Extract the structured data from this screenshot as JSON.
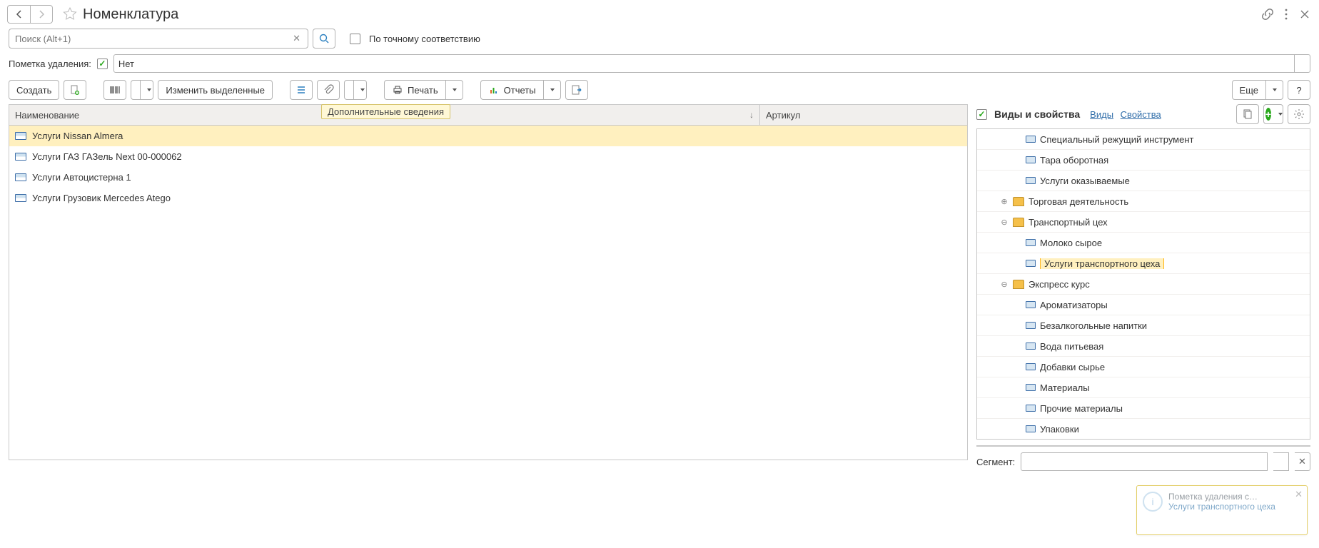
{
  "header": {
    "title": "Номенклатура",
    "search_placeholder": "Поиск (Alt+1)",
    "exact_match": "По точному соответствию",
    "filter_label": "Пометка удаления:",
    "filter_value": "Нет"
  },
  "toolbar": {
    "create": "Создать",
    "change_selected": "Изменить выделенные",
    "print": "Печать",
    "reports": "Отчеты",
    "more": "Еще",
    "help": "?",
    "tooltip": "Дополнительные сведения"
  },
  "table": {
    "columns": {
      "name": "Наименование",
      "article": "Артикул"
    },
    "rows": [
      {
        "name": "Услуги  Nissan Almera",
        "article": "",
        "selected": true
      },
      {
        "name": "Услуги  ГАЗ ГАЗель Next 00-000062",
        "article": "",
        "selected": false
      },
      {
        "name": "Услуги Автоцистерна 1",
        "article": "",
        "selected": false
      },
      {
        "name": "Услуги Грузовик Mercedes Atego",
        "article": "",
        "selected": false
      }
    ]
  },
  "right": {
    "title": "Виды и свойства",
    "link_types": "Виды",
    "link_props": "Свойства",
    "tree": [
      {
        "depth": 2,
        "exp": "",
        "kind": "leaf",
        "label": "Специальный режущий инструмент",
        "sel": false
      },
      {
        "depth": 2,
        "exp": "",
        "kind": "leaf",
        "label": "Тара оборотная",
        "sel": false
      },
      {
        "depth": 2,
        "exp": "",
        "kind": "leaf",
        "label": "Услуги оказываемые",
        "sel": false
      },
      {
        "depth": 1,
        "exp": "plus",
        "kind": "folder",
        "label": "Торговая деятельность",
        "sel": false
      },
      {
        "depth": 1,
        "exp": "minus",
        "kind": "folder",
        "label": "Транспортный  цех",
        "sel": false
      },
      {
        "depth": 2,
        "exp": "",
        "kind": "leaf",
        "label": "Молоко сырое",
        "sel": false
      },
      {
        "depth": 2,
        "exp": "",
        "kind": "leaf",
        "label": "Услуги  транспортного цеха",
        "sel": true
      },
      {
        "depth": 1,
        "exp": "minus",
        "kind": "folder",
        "label": "Экспресс курс",
        "sel": false
      },
      {
        "depth": 2,
        "exp": "",
        "kind": "leaf",
        "label": "Ароматизаторы",
        "sel": false
      },
      {
        "depth": 2,
        "exp": "",
        "kind": "leaf",
        "label": "Безалкогольные напитки",
        "sel": false
      },
      {
        "depth": 2,
        "exp": "",
        "kind": "leaf",
        "label": "Вода питьевая",
        "sel": false
      },
      {
        "depth": 2,
        "exp": "",
        "kind": "leaf",
        "label": "Добавки сырье",
        "sel": false
      },
      {
        "depth": 2,
        "exp": "",
        "kind": "leaf",
        "label": "Материалы",
        "sel": false
      },
      {
        "depth": 2,
        "exp": "",
        "kind": "leaf",
        "label": "Прочие материалы",
        "sel": false
      },
      {
        "depth": 2,
        "exp": "",
        "kind": "leaf",
        "label": "Упаковки",
        "sel": false
      }
    ],
    "segment_label": "Сегмент:"
  },
  "toast": {
    "line1": "Пометка удаления с…",
    "line2": "Услуги  транспортного цеха"
  }
}
